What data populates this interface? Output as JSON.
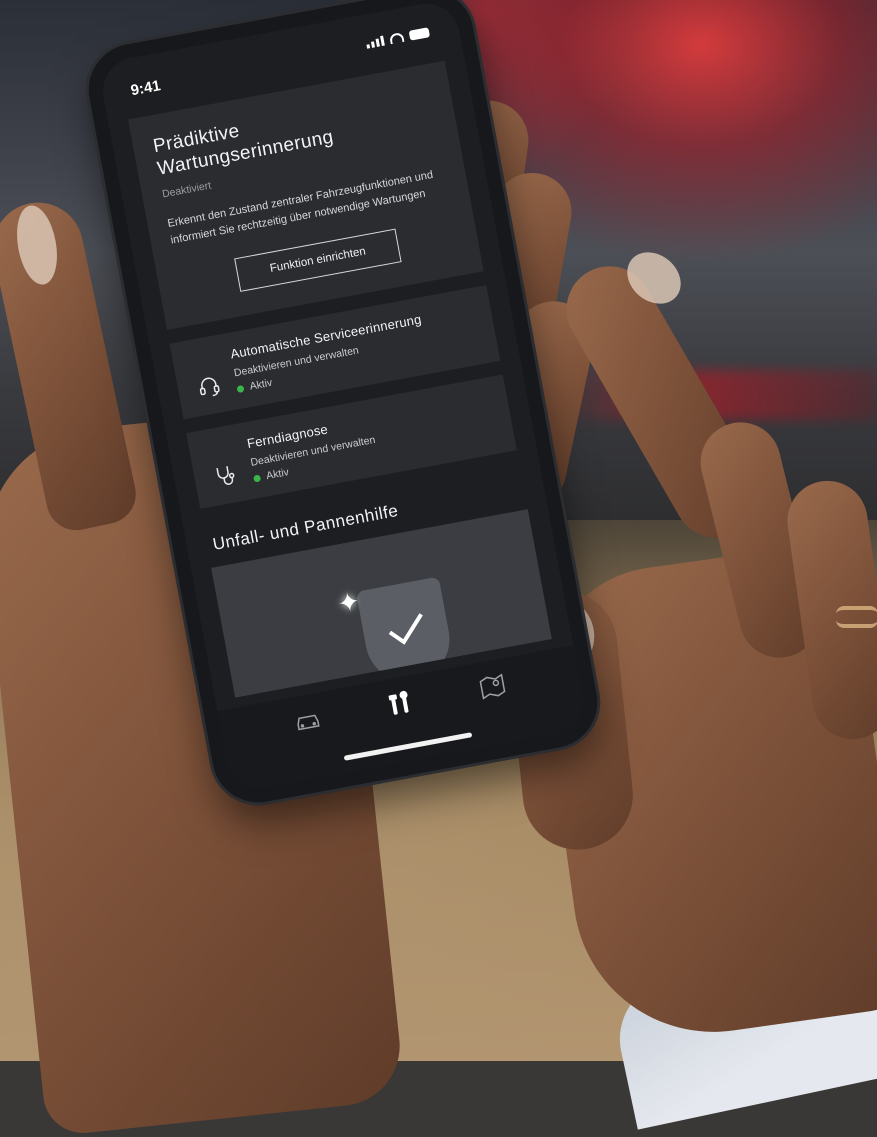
{
  "status_bar": {
    "time": "9:41"
  },
  "predictive_card": {
    "title_line1": "Prädiktive",
    "title_line2": "Wartungserinnerung",
    "status": "Deaktiviert",
    "description": "Erkennt den Zustand zentraler Fahrzeugfunktionen und informiert Sie rechtzeitig über notwendige Wartungen",
    "button_label": "Funktion einrichten"
  },
  "service_reminder": {
    "title": "Automatische Serviceerinnerung",
    "subtitle": "Deaktivieren und verwalten",
    "status": "Aktiv",
    "icon": "headset-icon"
  },
  "remote_diagnosis": {
    "title": "Ferndiagnose",
    "subtitle": "Deaktivieren und verwalten",
    "status": "Aktiv",
    "icon": "stethoscope-icon"
  },
  "accident_section": {
    "title": "Unfall- und Pannenhilfe"
  },
  "tab_bar": {
    "tabs": [
      {
        "icon": "car-icon",
        "active": false
      },
      {
        "icon": "tools-icon",
        "active": true
      },
      {
        "icon": "map-icon",
        "active": false
      }
    ]
  },
  "colors": {
    "status_active": "#39b54a",
    "card_background": "#2b2c30",
    "screen_background": "#1d1e21"
  }
}
